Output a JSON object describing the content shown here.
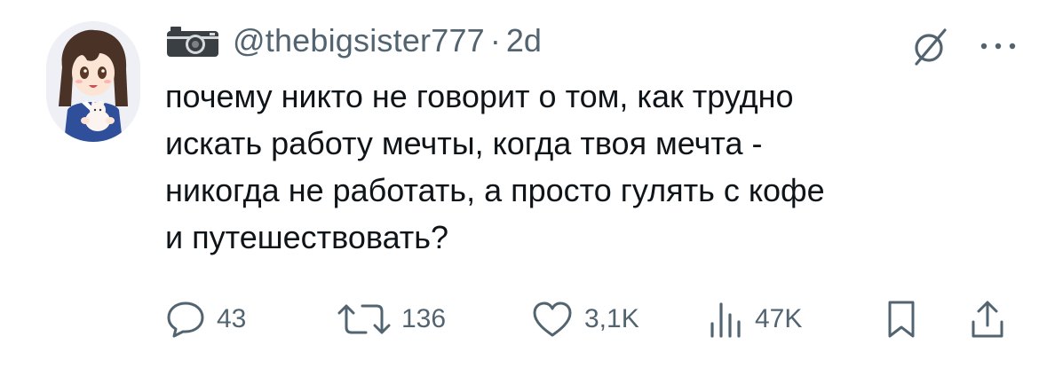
{
  "tweet": {
    "handle": "@thebigsister777",
    "separator": "·",
    "time": "2d",
    "text_lines": [
      "почему никто не говорит о том, как трудно",
      "искать работу мечты, когда твоя мечта -",
      "никогда не работать, а просто гулять с кофе",
      "и путешествовать?"
    ]
  },
  "actions": {
    "replies": "43",
    "reposts": "136",
    "likes": "3,1K",
    "views": "47K"
  },
  "icons": {
    "header": [
      "camera-icon",
      "grok-icon",
      "more-icon"
    ],
    "actions": [
      "reply-icon",
      "repost-icon",
      "like-icon",
      "views-icon",
      "bookmark-icon",
      "share-icon"
    ]
  },
  "colors": {
    "text": "#0f1419",
    "secondary": "#536471",
    "background": "#ffffff"
  }
}
